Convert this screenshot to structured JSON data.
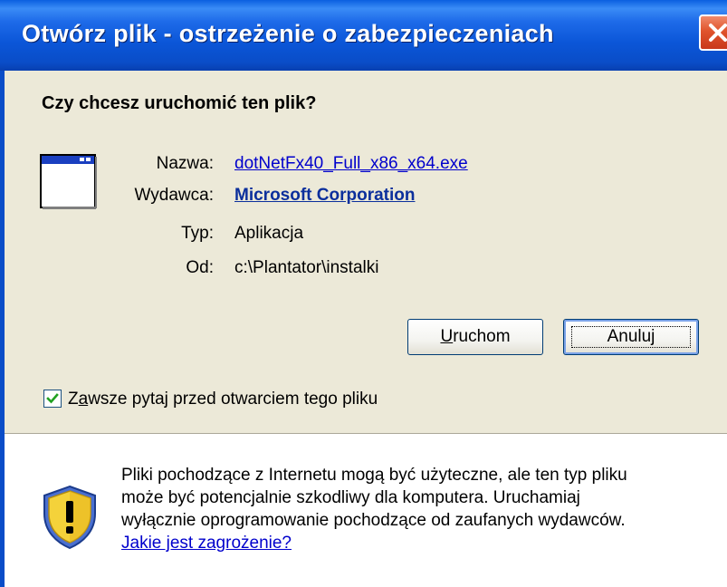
{
  "window": {
    "title": "Otwórz plik - ostrzeżenie o zabezpieczeniach"
  },
  "dialog": {
    "question": "Czy chcesz uruchomić ten plik?",
    "fields": [
      {
        "label": "Nazwa:",
        "value": "dotNetFx40_Full_x86_x64.exe"
      },
      {
        "label": "Wydawca:",
        "value": "Microsoft Corporation"
      },
      {
        "label": "Typ:",
        "value": "Aplikacja"
      },
      {
        "label": "Od:",
        "value": "c:\\Plantator\\instalki"
      }
    ],
    "buttons": {
      "run_label_accel": "U",
      "run_label_rest": "ruchom",
      "cancel_label": "Anuluj"
    },
    "checkbox": {
      "checked": true,
      "label_first": "Z",
      "label_accel": "a",
      "label_rest": "wsze pytaj przed otwarciem tego pliku"
    }
  },
  "warning": {
    "lines": [
      "Pliki pochodzące z Internetu mogą być użyteczne, ale ten typ pliku",
      "może być potencjalnie szkodliwy dla komputera. Uruchamiaj",
      "wyłącznie oprogramowanie pochodzące od zaufanych wydawców."
    ],
    "link": "Jakie jest zagrożenie?"
  },
  "icons": {
    "app": "application-window-icon",
    "shield": "security-shield-icon",
    "close": "close-icon",
    "check": "checkmark-icon"
  },
  "colors": {
    "titlebar": "#0A4DC8",
    "close_button": "#E0542C",
    "link": "#0000CC",
    "publisher": "#0B2F9C",
    "dialog_bg": "#ECE9D8"
  }
}
